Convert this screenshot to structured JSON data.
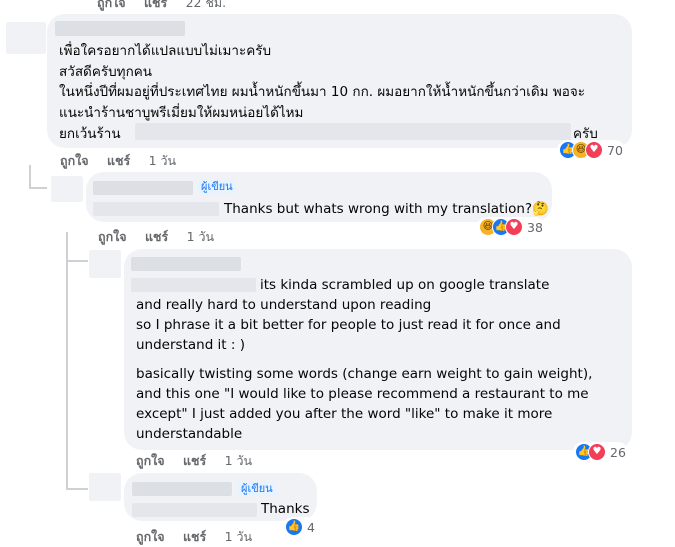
{
  "top_actions": {
    "like": "ถูกใจ",
    "share": "แชร์",
    "time": "22 ชม."
  },
  "comment1": {
    "lines": [
      "เพื่อใครอยากได้แปลแบบไม่เมาะครับ",
      "สวัสดีครับทุกคน",
      "ในหนึ่งปีที่ผมอยู่ที่ประเทศไทย ผมน้ำหนักขึ้นมา 10 กก. ผมอยากให้น้ำหนักขึ้นกว่าเดิม พอจะ",
      "แนะนำร้านชาบูพรีเมี่ยมให้ผมหน่อยได้ไหม",
      "ยกเว้นร้าน",
      "ครับ"
    ],
    "actions": {
      "like": "ถูกใจ",
      "share": "แชร์",
      "time": "1 วัน"
    },
    "reactions": {
      "icons": [
        "like-icon",
        "haha-icon",
        "love-icon"
      ],
      "count": "70"
    }
  },
  "comment2": {
    "badge": "ผู้เขียน",
    "text": "Thanks but whats wrong with my translation?",
    "emoji": "🤔",
    "actions": {
      "like": "ถูกใจ",
      "share": "แชร์",
      "time": "1 วัน"
    },
    "reactions": {
      "icons": [
        "haha-icon",
        "like-icon",
        "love-icon"
      ],
      "count": "38"
    }
  },
  "comment3": {
    "lines1": [
      "its kinda scrambled up on google translate",
      "and really hard to understand upon reading",
      "so I phrase it a bit better for people to just read it for once and",
      "understand it : )"
    ],
    "lines2": [
      "basically twisting some words (change earn weight to gain weight),",
      "and this one \"I would like to please recommend a restaurant to me",
      "except\" I just added you after the word \"like\" to make it more",
      "understandable"
    ],
    "actions": {
      "like": "ถูกใจ",
      "share": "แชร์",
      "time": "1 วัน"
    },
    "reactions": {
      "icons": [
        "like-icon",
        "love-icon"
      ],
      "count": "26"
    }
  },
  "comment4": {
    "badge": "ผู้เขียน",
    "text": "Thanks",
    "actions": {
      "like": "ถูกใจ",
      "share": "แชร์",
      "time": "1 วัน"
    },
    "reactions": {
      "icons": [
        "like-icon"
      ],
      "count": "4"
    }
  }
}
